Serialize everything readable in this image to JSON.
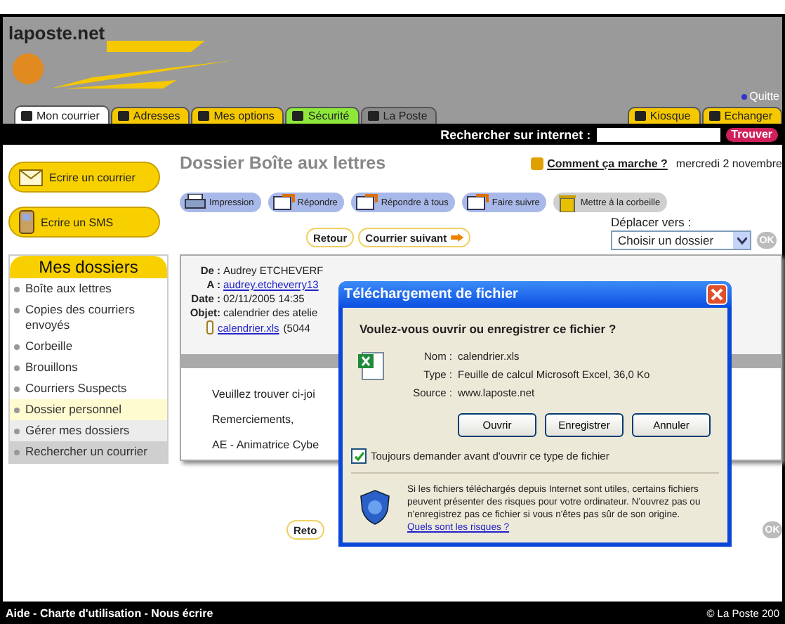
{
  "header": {
    "logo": "laposte.net",
    "quit": "Quitte"
  },
  "tabs": [
    {
      "label": "Mon courrier",
      "selected": true,
      "color": "#ffffff"
    },
    {
      "label": "Adresses",
      "selected": false,
      "color": "#f5c800"
    },
    {
      "label": "Mes options",
      "selected": false,
      "color": "#f5c800"
    },
    {
      "label": "Sécurité",
      "selected": false,
      "color": "#8ee83a"
    },
    {
      "label": "La Poste",
      "selected": false,
      "color": "#8a8a8a"
    }
  ],
  "right_tabs": [
    {
      "label": "Kiosque",
      "selected": false,
      "color": "#f5c800"
    },
    {
      "label": "Echanger",
      "selected": false,
      "color": "#f5c800"
    }
  ],
  "search": {
    "label": "Rechercher sur internet :",
    "button": "Trouver"
  },
  "actions": [
    {
      "label": "Ecrire un courrier",
      "kind": "letter"
    },
    {
      "label": "Ecrire un SMS",
      "kind": "phone"
    }
  ],
  "folders": {
    "title": "Mes dossiers",
    "items": [
      {
        "label": "Boîte aux lettres",
        "selected": false,
        "kind": "folder"
      },
      {
        "label": "Copies des courriers envoyés",
        "selected": false,
        "kind": "folder"
      },
      {
        "label": "Corbeille",
        "selected": false,
        "kind": "folder"
      },
      {
        "label": "Brouillons",
        "selected": false,
        "kind": "folder"
      },
      {
        "label": "Courriers Suspects",
        "selected": false,
        "kind": "folder"
      },
      {
        "label": "Dossier personnel",
        "selected": true,
        "kind": "folder"
      },
      {
        "label": "Gérer mes dossiers",
        "selected": false,
        "kind": "manage"
      },
      {
        "label": "Rechercher un courrier",
        "selected": false,
        "kind": "search"
      }
    ]
  },
  "page": {
    "title": "Dossier Boîte aux lettres",
    "help": "Comment ça marche ?",
    "date": "mercredi 2 novembre"
  },
  "toolbar": [
    {
      "label": "Impression",
      "kind": "print"
    },
    {
      "label": "Répondre",
      "kind": "mail"
    },
    {
      "label": "Répondre à tous",
      "kind": "mail"
    },
    {
      "label": "Faire suivre",
      "kind": "mail"
    },
    {
      "label": "Mettre à la corbeille",
      "kind": "trash"
    }
  ],
  "nav": [
    "Retour",
    "Courrier suivant"
  ],
  "move": {
    "label": "Déplacer vers :",
    "value": "Choisir un dossier",
    "button": "OK"
  },
  "message": {
    "fields": [
      {
        "label": "De :",
        "value": "Audrey ETCHEVERF",
        "kind": "text"
      },
      {
        "label": "A :",
        "value": "audrey.etcheverry13",
        "kind": "link"
      },
      {
        "label": "Date :",
        "value": "02/11/2005 14:35",
        "kind": "text"
      },
      {
        "label": "Objet:",
        "value": "calendrier des atelie",
        "kind": "text"
      }
    ],
    "attachment": "calendrier.xls",
    "attachment_size": "(5044",
    "body": [
      "Veuillez trouver ci-joi",
      "Remerciements,",
      "AE - Animatrice Cybe"
    ]
  },
  "bottom": {
    "nav": "Reto",
    "button": "OK"
  },
  "dialog": {
    "title": "Téléchargement de fichier",
    "question": "Voulez-vous ouvrir ou enregistrer ce fichier ?",
    "details": [
      {
        "label": "Nom :",
        "value": "calendrier.xls"
      },
      {
        "label": "Type :",
        "value": "Feuille de calcul Microsoft Excel, 36,0 Ko"
      },
      {
        "label": "Source :",
        "value": "www.laposte.net"
      }
    ],
    "buttons": [
      "Ouvrir",
      "Enregistrer",
      "Annuler"
    ],
    "always_ask": {
      "label": "Toujours demander avant d'ouvrir ce type de fichier",
      "checked": true
    },
    "warning": "Si les fichiers téléchargés depuis Internet sont utiles, certains fichiers peuvent présenter des risques pour votre ordinateur. N'ouvrez pas ou n'enregistrez pas ce fichier si vous n'êtes pas sûr de son origine.",
    "risk_link": "Quels sont les risques ?"
  },
  "footer": {
    "links": "Aide - Charte d'utilisation - Nous écrire",
    "copyright": "© La Poste 200"
  }
}
